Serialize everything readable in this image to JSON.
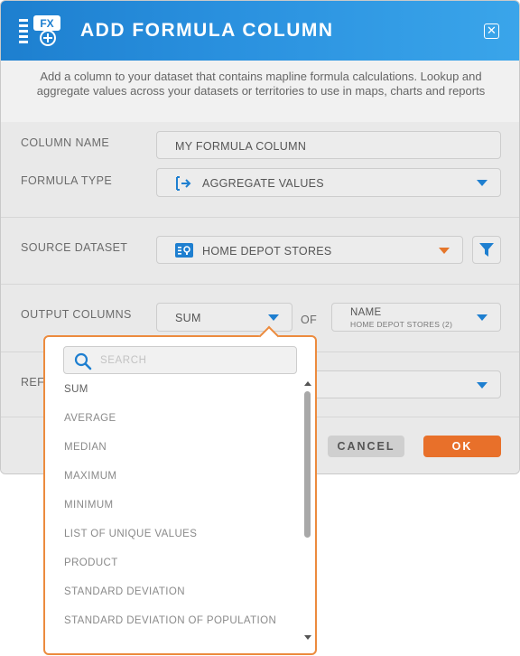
{
  "header": {
    "title": "ADD FORMULA COLUMN",
    "icon_badge": "FX",
    "close_icon": "close-icon"
  },
  "description": "Add a column to your dataset that contains mapline formula calculations. Lookup and aggregate values across your datasets or territories to use in maps, charts and reports",
  "form": {
    "column_name": {
      "label": "COLUMN NAME",
      "value": "MY FORMULA COLUMN"
    },
    "formula_type": {
      "label": "FORMULA TYPE",
      "value": "AGGREGATE VALUES",
      "icon": "aggregate-icon"
    },
    "source_dataset": {
      "label": "SOURCE DATASET",
      "value": "HOME DEPOT STORES",
      "icon": "dataset-icon",
      "filter_icon": "filter-icon"
    },
    "output_columns": {
      "label": "OUTPUT COLUMNS",
      "function": "SUM",
      "of_label": "OF",
      "column": "NAME",
      "column_sub": "HOME DEPOT STORES (2)"
    },
    "ref_label": "REF"
  },
  "buttons": {
    "cancel": "CANCEL",
    "ok": "OK"
  },
  "dropdown": {
    "search_placeholder": "SEARCH",
    "options": [
      "SUM",
      "AVERAGE",
      "MEDIAN",
      "MAXIMUM",
      "MINIMUM",
      "LIST OF UNIQUE VALUES",
      "PRODUCT",
      "STANDARD DEVIATION",
      "STANDARD DEVIATION OF POPULATION"
    ]
  },
  "colors": {
    "accent_blue": "#1e7fd0",
    "accent_orange": "#e8702a",
    "header_start": "#1d7fcf",
    "header_end": "#3aa5ea"
  }
}
